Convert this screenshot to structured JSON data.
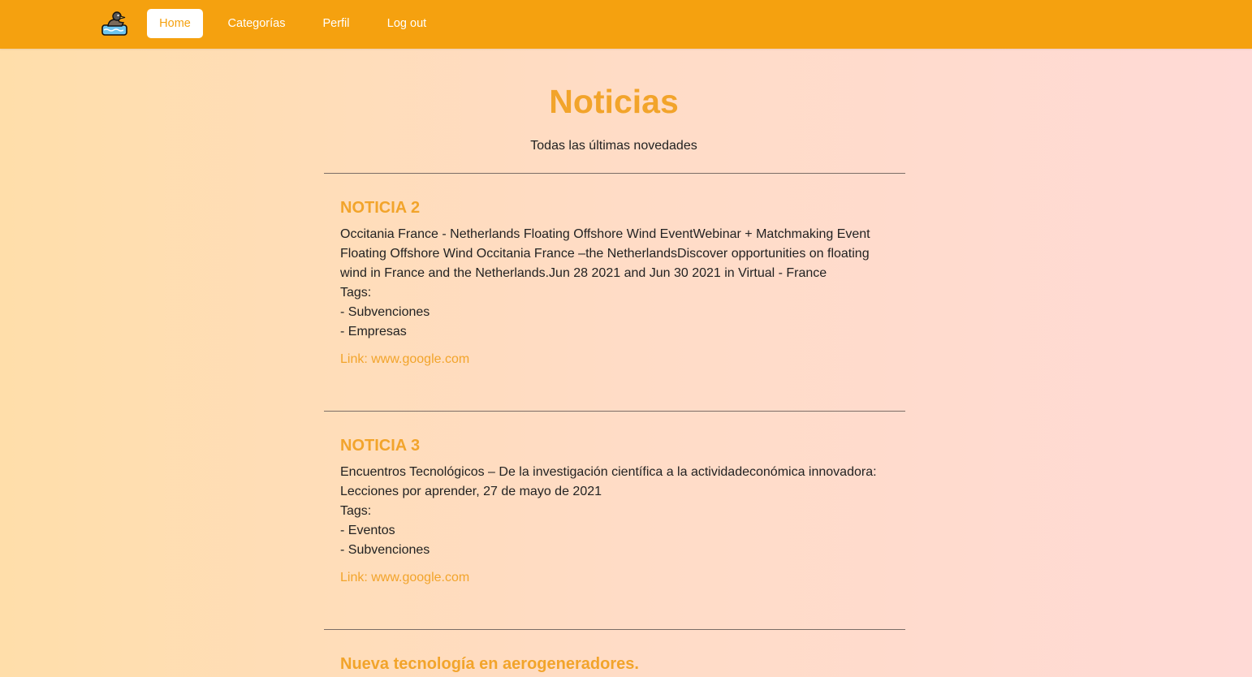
{
  "nav": {
    "logo_icon": "duck-on-water-icon",
    "items": [
      {
        "label": "Home",
        "active": true
      },
      {
        "label": "Categorías",
        "active": false
      },
      {
        "label": "Perfil",
        "active": false
      },
      {
        "label": "Log out",
        "active": false
      }
    ]
  },
  "header": {
    "title": "Noticias",
    "subtitle": "Todas las últimas novedades"
  },
  "news": [
    {
      "title": "NOTICIA 2",
      "description": "Occitania France - Netherlands Floating Offshore Wind EventWebinar + Matchmaking Event Floating Offshore Wind Occitania France –the NetherlandsDiscover opportunities on floating wind in France and the Netherlands.Jun 28 2021 and Jun 30 2021 in Virtual - France",
      "tags_label": "Tags:",
      "tags": [
        "- Subvenciones",
        "- Empresas"
      ],
      "link": "Link: www.google.com"
    },
    {
      "title": "NOTICIA 3",
      "description": "Encuentros Tecnológicos – De la investigación científica a la actividadeconómica innovadora: Lecciones por aprender, 27 de mayo de 2021",
      "tags_label": "Tags:",
      "tags": [
        "- Eventos",
        "- Subvenciones"
      ],
      "link": "Link: www.google.com"
    },
    {
      "title": "Nueva tecnología en aerogeneradores."
    }
  ],
  "colors": {
    "accent": "#f5a10f",
    "title": "#f2a42b",
    "text": "#222222"
  }
}
